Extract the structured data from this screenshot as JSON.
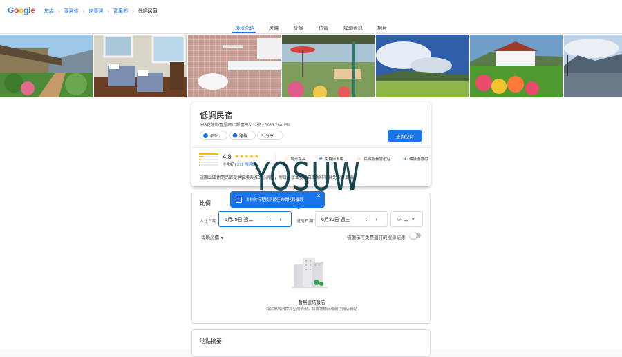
{
  "brand": {
    "logo_text": "Google",
    "logo_letters": [
      "G",
      "o",
      "o",
      "g",
      "l",
      "e"
    ],
    "logo_colors": [
      "#4285f4",
      "#ea4335",
      "#fbbc05",
      "#4285f4",
      "#34a853",
      "#ea4335"
    ]
  },
  "breadcrumb": {
    "items": [
      "旅店",
      "臺灣省",
      "東臺灣",
      "富里鄉"
    ],
    "current": "低調民宿",
    "separator": "›"
  },
  "tabs": [
    "環境介紹",
    "房價",
    "評論",
    "位置",
    "詳細資訊",
    "相片"
  ],
  "hotel": {
    "name": "低調民宿",
    "address": "983花蓮縣富里鄉10鄰富田81-2號 • 0933 766 153",
    "actions": {
      "website": "網站",
      "directions": "路線",
      "share": "分享"
    },
    "cta": "查詢空房",
    "rating": {
      "score": "4.8",
      "stars": "★★★★★",
      "label": "非常好",
      "separator": " | ",
      "count": "271 則評論"
    },
    "amenities": [
      {
        "icon": "☆",
        "label": "評分最高"
      },
      {
        "icon": "P",
        "label": "免費停車場"
      },
      {
        "icon": "▭",
        "label": "民宿服務會歡迎"
      },
      {
        "icon": "➜",
        "label": "轉接優惠付"
      }
    ],
    "description": "這間山區休閒民宿提供裝潢典雅的小房間，附設早餐並提供自助咖啡機與免費停車場"
  },
  "pricing": {
    "title": "比價",
    "tooltip": "為你的行程找到最佳的價格和優惠",
    "tooltip_close": "✕",
    "checkin_label": "入住日期",
    "checkin_value": "6月29日 週二",
    "checkout_label": "退房日期",
    "checkout_value": "6月30日 週三",
    "date_nav": "‹ ›",
    "guests_value": "二",
    "per_night": "每晚房價",
    "free_cancel": "僅顯示可免費退訂的搜尋結果",
    "empty_title": "暫無連結飯店",
    "empty_sub": "如需瞭解房價和空房情況，請致電飯店或前往飯店網站"
  },
  "location": {
    "title": "地點摘要"
  },
  "watermark": "YOSUW",
  "colors": {
    "accent": "#1a73e8",
    "star": "#fbbc04"
  }
}
